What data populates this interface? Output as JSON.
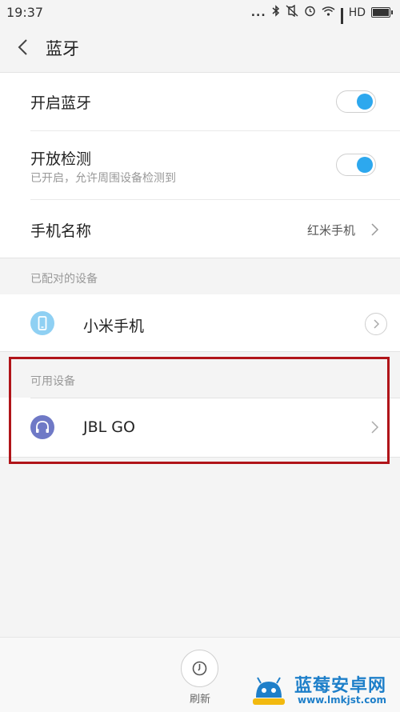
{
  "status_bar": {
    "time": "19:37",
    "dots": "...",
    "network": "HD"
  },
  "header": {
    "title": "蓝牙"
  },
  "settings": {
    "bluetooth_on": {
      "label": "开启蓝牙",
      "enabled": true
    },
    "discoverable": {
      "label": "开放检测",
      "sub": "已开启，允许周围设备检测到",
      "enabled": true
    },
    "device_name": {
      "label": "手机名称",
      "value": "红米手机"
    }
  },
  "paired": {
    "header": "已配对的设备",
    "devices": [
      {
        "name": "小米手机",
        "icon": "phone-icon"
      }
    ]
  },
  "available": {
    "header": "可用设备",
    "devices": [
      {
        "name": "JBL GO",
        "icon": "headphones-icon"
      }
    ]
  },
  "bottom": {
    "refresh_label": "刷新"
  },
  "watermark": {
    "title": "蓝莓安卓网",
    "url": "www.lmkjst.com"
  },
  "colors": {
    "accent": "#2da8ee",
    "highlight_box": "#b01419",
    "phone_icon_bg": "#8fd0f3",
    "headphones_icon_bg": "#6f79c6"
  }
}
